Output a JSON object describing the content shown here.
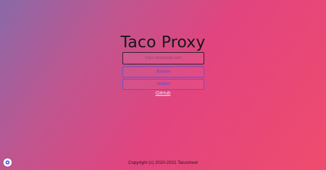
{
  "header": {
    "title": "Taco Proxy"
  },
  "form": {
    "url_placeholder": "https://example.com",
    "browse_label": "Browse",
    "hidden_label": "Hidden"
  },
  "links": {
    "github_label": "GitHub"
  },
  "footer": {
    "copyright": "Copyright (c) 2020-2021 Tacosheel"
  },
  "colors": {
    "accent": "#5a4bd6",
    "badge_icon": "#5b5fe8"
  },
  "icons": {
    "corner_badge": "settings-icon"
  }
}
